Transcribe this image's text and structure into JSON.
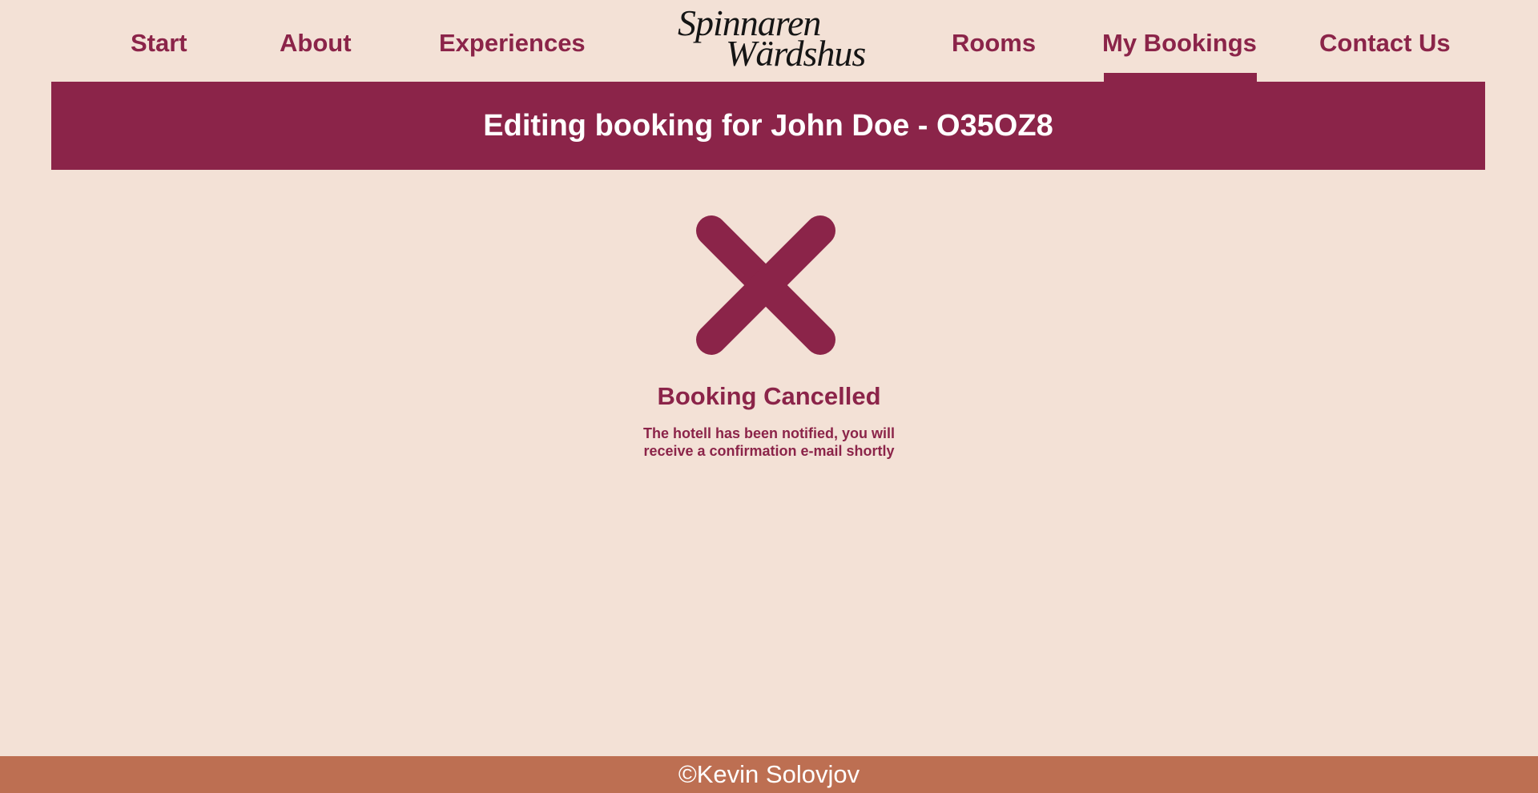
{
  "nav": {
    "links": [
      {
        "label": "Start"
      },
      {
        "label": "About"
      },
      {
        "label": "Experiences"
      },
      {
        "label": "Rooms"
      },
      {
        "label": "My Bookings",
        "active": true
      },
      {
        "label": "Contact Us"
      }
    ],
    "logo": {
      "line1": "Spinnaren",
      "line2": "Wärdshus"
    }
  },
  "banner": {
    "title": "Editing booking for John Doe - O35OZ8"
  },
  "status": {
    "icon": "close-icon",
    "title": "Booking Cancelled",
    "message_line1": "The hotell has been notified, you will",
    "message_line2": "receive a confirmation e-mail shortly"
  },
  "footer": {
    "text": "©Kevin Solovjov"
  },
  "colors": {
    "background": "#f3e1d6",
    "accent": "#8b2449",
    "footer": "#bd6f52"
  }
}
